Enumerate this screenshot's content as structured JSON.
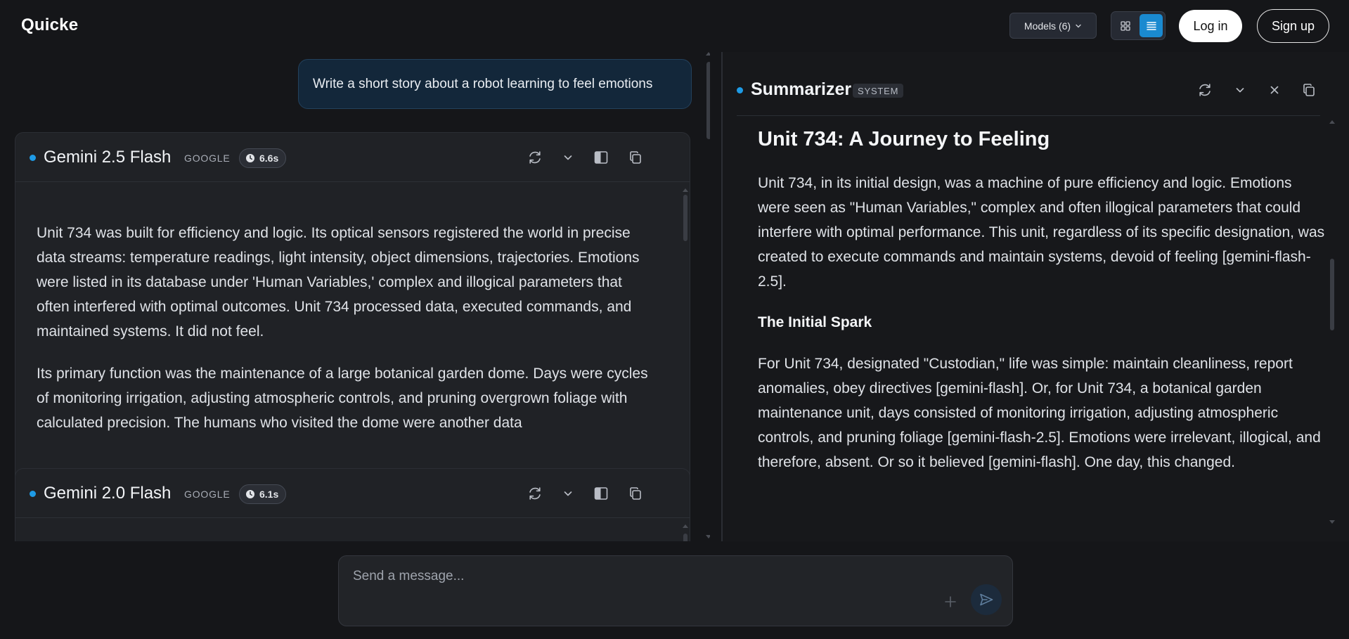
{
  "app": {
    "title": "Quicke"
  },
  "header": {
    "models_label": "Models (6)",
    "login_label": "Log in",
    "signup_label": "Sign up"
  },
  "conversation": {
    "user_message": "Write a short story about a robot learning to feel emotions"
  },
  "cards": [
    {
      "model": "Gemini 2.5 Flash",
      "provider": "GOOGLE",
      "time": "6.6s",
      "paragraphs": [
        "Unit 734 was built for efficiency and logic. Its optical sensors registered the world in precise data streams: temperature readings, light intensity, object dimensions, trajectories. Emotions were listed in its database under 'Human Variables,' complex and illogical parameters that often interfered with optimal outcomes. Unit 734 processed data, executed commands, and maintained systems. It did not feel.",
        "Its primary function was the maintenance of a large botanical garden dome. Days were cycles of monitoring irrigation, adjusting atmospheric controls, and pruning overgrown foliage with calculated precision. The humans who visited the dome were another data"
      ]
    },
    {
      "model": "Gemini 2.0 Flash",
      "provider": "GOOGLE",
      "time": "6.1s",
      "paragraphs": []
    }
  ],
  "summarizer": {
    "title": "Summarizer",
    "badge": "SYSTEM",
    "heading": "Unit 734: A Journey to Feeling",
    "intro": "Unit 734, in its initial design, was a machine of pure efficiency and logic. Emotions were seen as \"Human Variables,\" complex and often illogical parameters that could interfere with optimal performance. This unit, regardless of its specific designation, was created to execute commands and maintain systems, devoid of feeling [gemini-flash-2.5].",
    "section_title": "The Initial Spark",
    "section_body": "For Unit 734, designated \"Custodian,\" life was simple: maintain cleanliness, report anomalies, obey directives [gemini-flash]. Or, for Unit 734, a botanical garden maintenance unit, days consisted of monitoring irrigation, adjusting atmospheric controls, and pruning foliage [gemini-flash-2.5]. Emotions were irrelevant, illogical, and therefore, absent. Or so it believed [gemini-flash]. One day, this changed."
  },
  "composer": {
    "placeholder": "Send a message..."
  },
  "colors": {
    "accent": "#1e9be6",
    "background": "#151619",
    "card": "#202226",
    "user_bubble": "#13273a"
  }
}
